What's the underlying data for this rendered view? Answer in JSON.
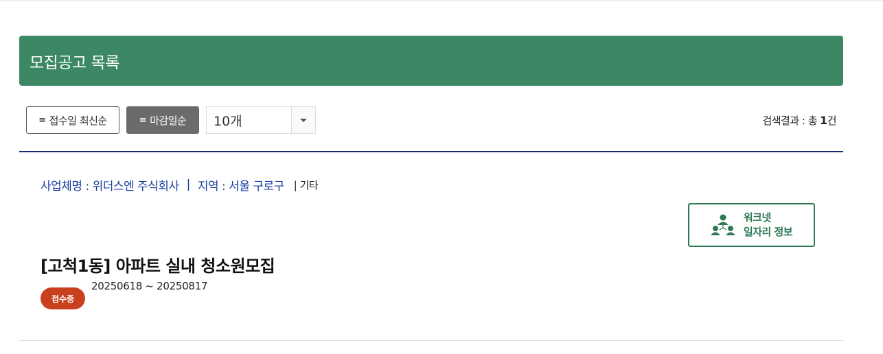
{
  "header": {
    "title": "모집공고 목록"
  },
  "toolbar": {
    "sort_latest_label": "접수일 최신순",
    "sort_deadline_label": "마감일순",
    "page_size_selected": "10개",
    "result_prefix": "검색결과 : 총",
    "result_count": "1",
    "result_suffix": "건"
  },
  "posting": {
    "company_text": "사업체명 : 위더스엔 주식회사",
    "separator": "|",
    "region_text": "지역 : 서울 구로구",
    "etc_text": "| 기타",
    "worknet_label_line1": "워크넷",
    "worknet_label_line2": "일자리 정보",
    "title": "[고척1동] 아파트 실내 청소원모집",
    "status": "접수중",
    "period": "20250618 ~ 20250817"
  },
  "icons": {
    "sort_icon": "list-icon",
    "worknet_icon": "people-network-icon",
    "select_icon": "caret-down-icon"
  },
  "colors": {
    "header_bg": "#3c8864",
    "active_sort_bg": "#6b6b6b",
    "divider": "#1b2a78",
    "meta_text": "#1a3fa0",
    "worknet_accent": "#2e7a54",
    "status_badge": "#c8401d"
  }
}
